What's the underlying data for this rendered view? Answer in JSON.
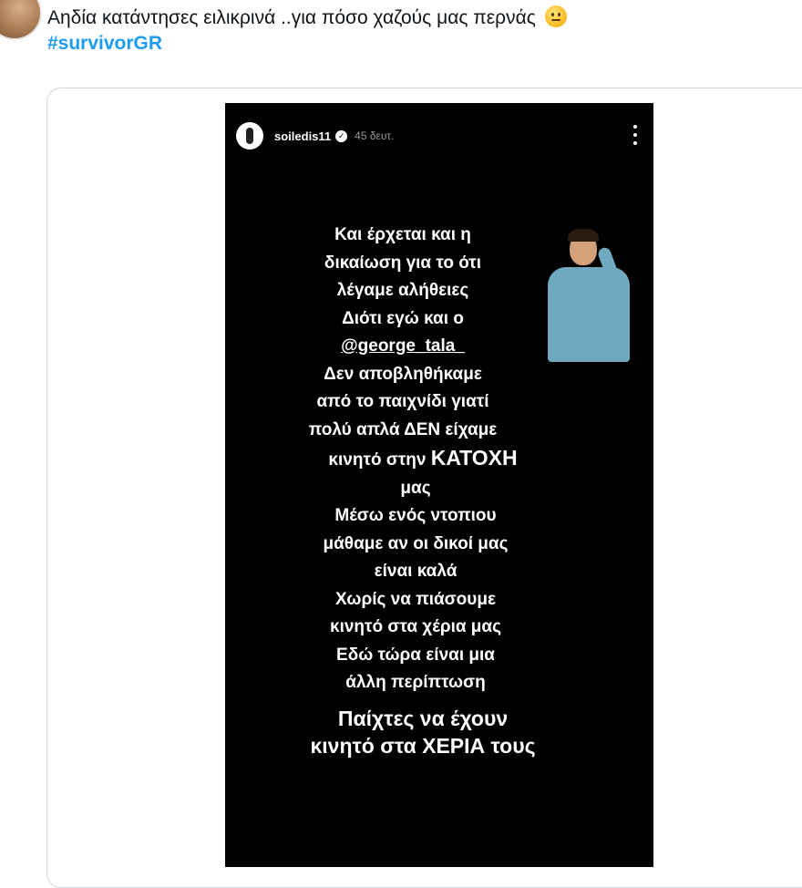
{
  "tweet": {
    "text": "Αηδία κατάντησες ειλικρινά ..για πόσο χαζούς μας περνάς",
    "emoji": "slightly-frowning-face-emoji",
    "hashtag": "#survivorGR"
  },
  "story": {
    "username": "soiledis11",
    "timestamp": "45 δευτ.",
    "lines": [
      "Και έρχεται και η",
      "δικαίωση για το ότι",
      "λέγαμε αλήθειες",
      "Διότι εγώ και ο",
      "@george_tala_",
      "Δεν αποβληθήκαμε",
      "από το παιχνίδι γιατί",
      "πολύ απλά ΔΕΝ είχαμε",
      "κινητό στην",
      "ΚΑΤΟΧΗ",
      "μας",
      "Μέσω ενός ντοπιου",
      "μάθαμε αν οι δικοί μας",
      "είναι καλά",
      "Χωρίς να πιάσουμε",
      "κινητό στα χέρια μας",
      "Εδώ τώρα  είναι μια",
      "άλλη περίπτωση",
      "Παίχτες να έχουν",
      "κινητό στα ΧΕΡΙΑ τους"
    ]
  },
  "colors": {
    "hashtag": "#1d9bf0",
    "story_background": "#000000",
    "story_text": "#ffffff"
  }
}
